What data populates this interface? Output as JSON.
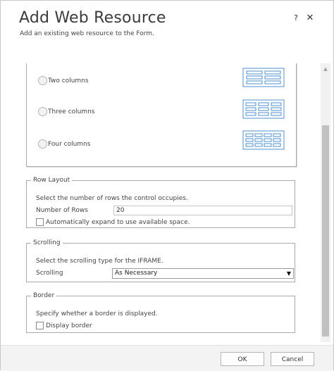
{
  "dialog": {
    "title": "Add Web Resource",
    "subtitle": "Add an existing web resource to the Form.",
    "help_label": "?",
    "close_label": "✕"
  },
  "columns": {
    "options": [
      {
        "label": "Two columns",
        "icon": "two-column-layout-icon",
        "selected": false
      },
      {
        "label": "Three columns",
        "icon": "three-column-layout-icon",
        "selected": false
      },
      {
        "label": "Four columns",
        "icon": "four-column-layout-icon",
        "selected": false
      }
    ]
  },
  "row_layout": {
    "legend": "Row Layout",
    "description": "Select the number of rows the control occupies.",
    "rows_label": "Number of Rows",
    "rows_value": "20",
    "auto_expand_label": "Automatically expand to use available space.",
    "auto_expand_checked": false
  },
  "scrolling": {
    "legend": "Scrolling",
    "description": "Select the scrolling type for the IFRAME.",
    "label": "Scrolling",
    "value": "As Necessary"
  },
  "border": {
    "legend": "Border",
    "description": "Specify whether a border is displayed.",
    "display_border_label": "Display border",
    "display_border_checked": false
  },
  "footer": {
    "ok_label": "OK",
    "cancel_label": "Cancel"
  },
  "colors": {
    "layout_icon_stroke": "#4d8fcc",
    "layout_icon_fill": "#ffffff"
  }
}
